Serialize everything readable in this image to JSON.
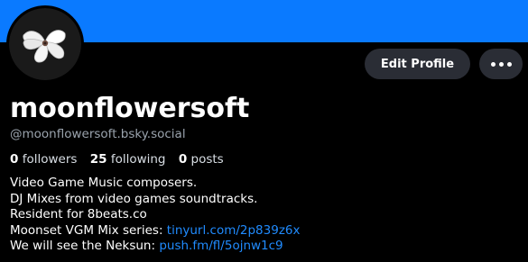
{
  "colors": {
    "banner": "#0a7aff",
    "background": "#000000",
    "button_bg": "#2a2d35",
    "link": "#208bfe",
    "muted_text": "#9aa3ad"
  },
  "avatar": {
    "icon": "moonflower-avatar-icon"
  },
  "actions": {
    "edit_profile_label": "Edit Profile",
    "more_icon": "ellipsis-icon"
  },
  "profile": {
    "display_name": "moonflowersoft",
    "handle": "@moonflowersoft.bsky.social"
  },
  "stats": {
    "followers_count": "0",
    "followers_label": "followers",
    "following_count": "25",
    "following_label": "following",
    "posts_count": "0",
    "posts_label": "posts"
  },
  "bio": {
    "line1": "Video Game Music composers.",
    "line2": "DJ Mixes from video games soundtracks.",
    "line3": "Resident for 8beats.co",
    "line4_text": "Moonset VGM Mix series: ",
    "line4_link": "tinyurl.com/2p839z6x",
    "line5_text": "We will see the Neksun: ",
    "line5_link": "push.fm/fl/5ojnw1c9"
  }
}
